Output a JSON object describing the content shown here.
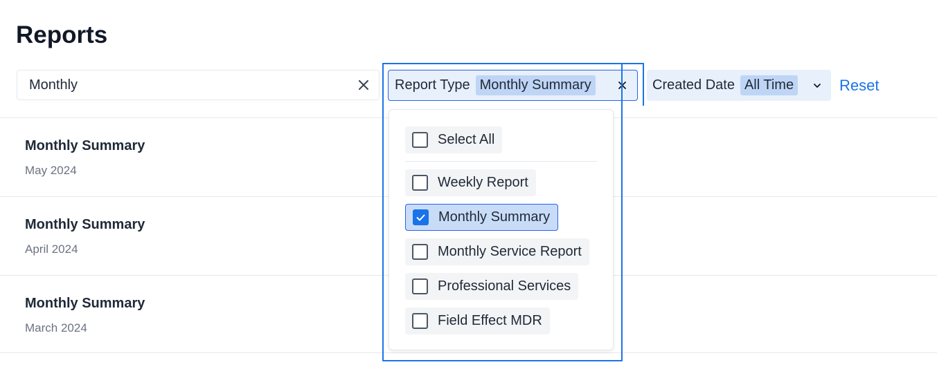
{
  "page": {
    "title": "Reports"
  },
  "search": {
    "value": "Monthly"
  },
  "filters": {
    "report_type": {
      "label": "Report Type",
      "selected": "Monthly Summary"
    },
    "created_date": {
      "label": "Created Date",
      "selected": "All Time"
    },
    "reset_label": "Reset"
  },
  "dropdown": {
    "select_all": "Select All",
    "options": [
      {
        "label": "Weekly Report",
        "checked": false
      },
      {
        "label": "Monthly Summary",
        "checked": true
      },
      {
        "label": "Monthly Service Report",
        "checked": false
      },
      {
        "label": "Professional Services",
        "checked": false
      },
      {
        "label": "Field Effect MDR",
        "checked": false
      }
    ]
  },
  "reports": [
    {
      "title": "Monthly Summary",
      "date": "May 2024"
    },
    {
      "title": "Monthly Summary",
      "date": "April 2024"
    },
    {
      "title": "Monthly Summary",
      "date": "March 2024"
    }
  ],
  "colors": {
    "accent": "#1a73e8",
    "chip": "#bfd5f5",
    "filter_bg": "#e8f0fc"
  }
}
